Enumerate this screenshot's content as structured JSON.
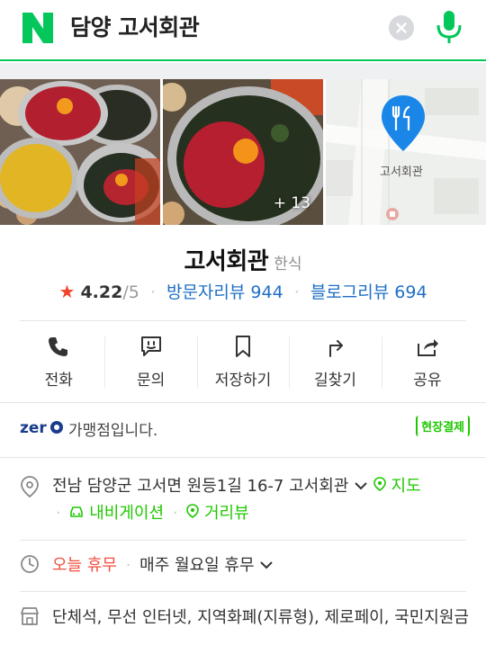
{
  "search": {
    "query": "담양 고서회관"
  },
  "colors": {
    "brand": "#03c75a",
    "link": "#1f6fc5",
    "zeropay": "#1ec800",
    "star": "#f0432c",
    "closed": "#f24e3f"
  },
  "photos": {
    "more_count": "+ 13",
    "map_label": "고서회관"
  },
  "place": {
    "name": "고서회관",
    "category": "한식",
    "rating": "4.22",
    "rating_max": "/5",
    "visitor_reviews": "방문자리뷰 944",
    "blog_reviews": "블로그리뷰 694"
  },
  "actions": [
    {
      "label": "전화",
      "icon": "phone-icon"
    },
    {
      "label": "문의",
      "icon": "chat-icon"
    },
    {
      "label": "저장하기",
      "icon": "bookmark-icon"
    },
    {
      "label": "길찾기",
      "icon": "directions-icon"
    },
    {
      "label": "공유",
      "icon": "share-icon"
    }
  ],
  "zeropay": {
    "text": "가맹점입니다.",
    "badge": "현장결제"
  },
  "address": {
    "text": "전남 담양군 고서면 원등1길 16-7 고서회관",
    "map_link": "지도",
    "navigation": "내비게이션",
    "street_view": "거리뷰"
  },
  "hours": {
    "status": "오늘 휴무",
    "detail": "매주 월요일 휴무"
  },
  "amenities": {
    "text": "단체석, 무선 인터넷, 지역화폐(지류형), 제로페이, 국민지원금"
  }
}
